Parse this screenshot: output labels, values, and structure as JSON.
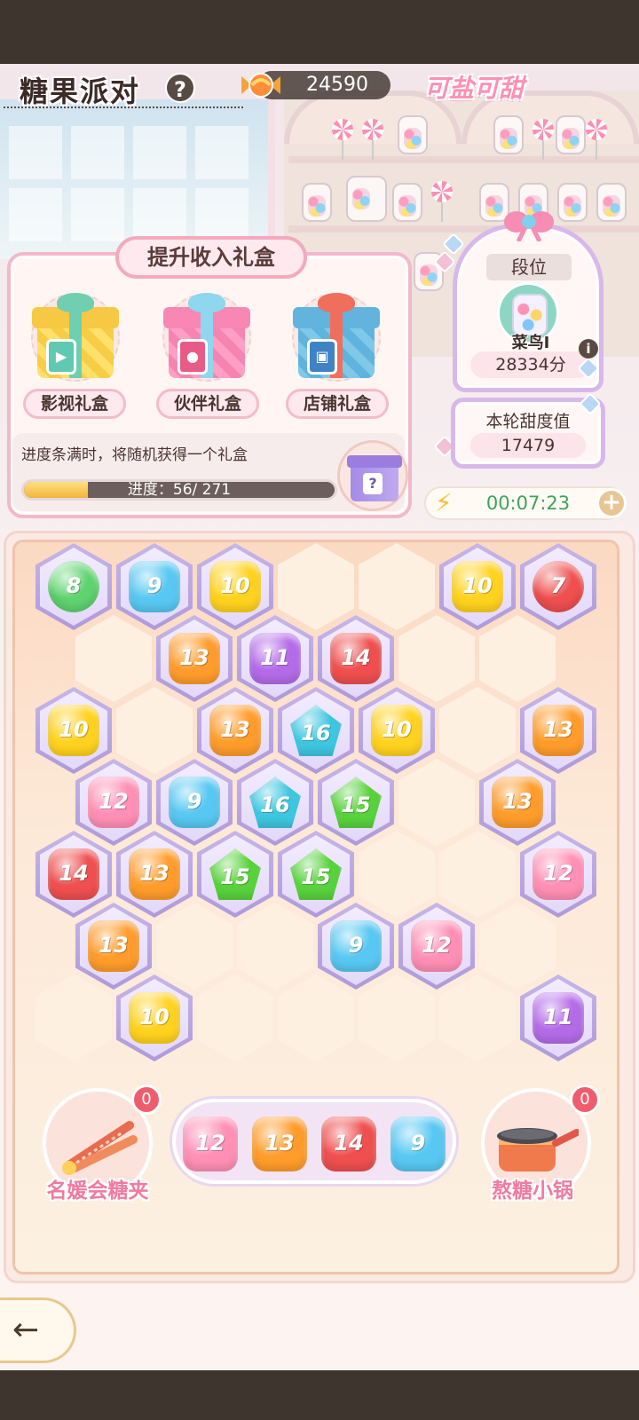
{
  "header": {
    "title": "糖果派对",
    "help_icon": "question-mark-icon",
    "candy_currency": "24590",
    "brand_logo": "可盐可甜"
  },
  "gift_panel": {
    "title": "提升收入礼盒",
    "gifts": [
      {
        "label": "影视礼盒",
        "icon": "film-tag-icon"
      },
      {
        "label": "伙伴礼盒",
        "icon": "person-tag-icon"
      },
      {
        "label": "店铺礼盒",
        "icon": "shop-tag-icon"
      }
    ],
    "hint": "进度条满时，将随机获得一个礼盒",
    "progress_text": "进度：56/ 271",
    "progress_current": 56,
    "progress_total": 271
  },
  "rank": {
    "title": "段位",
    "name": "菜鸟Ⅰ",
    "score": "28334分"
  },
  "sweetness": {
    "label": "本轮甜度值",
    "value": "17479"
  },
  "energy": {
    "timer": "00:07:23"
  },
  "colors": {
    "green": "#5fd36f",
    "blue": "#58c8f2",
    "yellow": "#ffd21f",
    "red": "#ef4f4f",
    "orange": "#ff9c2b",
    "purple": "#b46be8",
    "pink": "#ff8fb4",
    "teal": "#3ec6e0",
    "lime": "#58d23c"
  },
  "board": {
    "candies": [
      {
        "row": 0,
        "col": 0,
        "value": "8",
        "color": "green",
        "shape": "round"
      },
      {
        "row": 0,
        "col": 1,
        "value": "9",
        "color": "blue",
        "shape": "rounded"
      },
      {
        "row": 0,
        "col": 2,
        "value": "10",
        "color": "yellow",
        "shape": "rounded"
      },
      {
        "row": 0,
        "col": 5,
        "value": "10",
        "color": "yellow",
        "shape": "rounded"
      },
      {
        "row": 0,
        "col": 6,
        "value": "7",
        "color": "red",
        "shape": "round"
      },
      {
        "row": 1,
        "col": 1,
        "value": "13",
        "color": "orange",
        "shape": "rounded"
      },
      {
        "row": 1,
        "col": 2,
        "value": "11",
        "color": "purple",
        "shape": "rounded"
      },
      {
        "row": 1,
        "col": 3,
        "value": "14",
        "color": "red",
        "shape": "rounded"
      },
      {
        "row": 2,
        "col": 0,
        "value": "10",
        "color": "yellow",
        "shape": "rounded"
      },
      {
        "row": 2,
        "col": 2,
        "value": "13",
        "color": "orange",
        "shape": "rounded"
      },
      {
        "row": 2,
        "col": 3,
        "value": "16",
        "color": "teal",
        "shape": "penta"
      },
      {
        "row": 2,
        "col": 4,
        "value": "10",
        "color": "yellow",
        "shape": "rounded"
      },
      {
        "row": 2,
        "col": 6,
        "value": "13",
        "color": "orange",
        "shape": "rounded"
      },
      {
        "row": 3,
        "col": 0,
        "value": "12",
        "color": "pink",
        "shape": "rounded"
      },
      {
        "row": 3,
        "col": 1,
        "value": "9",
        "color": "blue",
        "shape": "rounded"
      },
      {
        "row": 3,
        "col": 2,
        "value": "16",
        "color": "teal",
        "shape": "penta"
      },
      {
        "row": 3,
        "col": 3,
        "value": "15",
        "color": "lime",
        "shape": "penta"
      },
      {
        "row": 3,
        "col": 5,
        "value": "13",
        "color": "orange",
        "shape": "rounded"
      },
      {
        "row": 4,
        "col": 0,
        "value": "14",
        "color": "red",
        "shape": "rounded"
      },
      {
        "row": 4,
        "col": 1,
        "value": "13",
        "color": "orange",
        "shape": "rounded"
      },
      {
        "row": 4,
        "col": 2,
        "value": "15",
        "color": "lime",
        "shape": "penta"
      },
      {
        "row": 4,
        "col": 3,
        "value": "15",
        "color": "lime",
        "shape": "penta"
      },
      {
        "row": 4,
        "col": 6,
        "value": "12",
        "color": "pink",
        "shape": "rounded"
      },
      {
        "row": 5,
        "col": 0,
        "value": "13",
        "color": "orange",
        "shape": "rounded"
      },
      {
        "row": 5,
        "col": 3,
        "value": "9",
        "color": "blue",
        "shape": "rounded"
      },
      {
        "row": 5,
        "col": 4,
        "value": "12",
        "color": "pink",
        "shape": "rounded"
      },
      {
        "row": 6,
        "col": 1,
        "value": "10",
        "color": "yellow",
        "shape": "rounded"
      },
      {
        "row": 6,
        "col": 6,
        "value": "11",
        "color": "purple",
        "shape": "rounded"
      }
    ]
  },
  "tray": {
    "candies": [
      {
        "value": "12",
        "color": "pink"
      },
      {
        "value": "13",
        "color": "orange"
      },
      {
        "value": "14",
        "color": "red"
      },
      {
        "value": "9",
        "color": "blue"
      }
    ]
  },
  "tools": {
    "tongs": {
      "label": "名媛会糖夹",
      "count": "0"
    },
    "pot": {
      "label": "熬糖小锅",
      "count": "0"
    }
  }
}
